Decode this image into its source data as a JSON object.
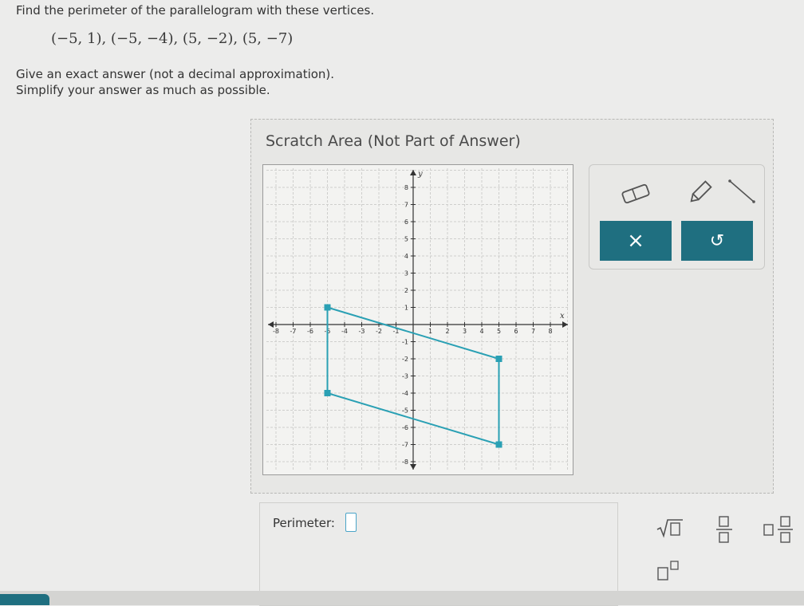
{
  "question": {
    "prompt": "Find the perimeter of the parallelogram with these vertices.",
    "vertices": "(−5, 1), (−5, −4), (5, −2), (5, −7)",
    "instruction_exact": "Give an exact answer (not a decimal approximation).",
    "instruction_simplify": "Simplify your answer as much as possible."
  },
  "scratch": {
    "title": "Scratch Area (Not Part of Answer)"
  },
  "tools": {
    "eraser_icon": "eraser-icon",
    "pencil_icon": "pencil-icon",
    "line_icon": "line-tool-icon",
    "clear_label": "×",
    "undo_label": "↺"
  },
  "answer": {
    "label": "Perimeter:",
    "value": ""
  },
  "colors": {
    "accent": "#1f6f80",
    "shape": "#2aa0b4",
    "input_border": "#4aa4c8"
  },
  "chart_data": {
    "type": "scatter",
    "xlabel": "x",
    "ylabel": "y",
    "xlim": [
      -9,
      9
    ],
    "ylim": [
      -9,
      9
    ],
    "grid": true,
    "x_ticks": [
      -8,
      -7,
      -6,
      -5,
      -4,
      -3,
      -2,
      -1,
      1,
      2,
      3,
      4,
      5,
      6,
      7,
      8
    ],
    "y_ticks": [
      -8,
      -7,
      -6,
      -5,
      -4,
      -3,
      -2,
      -1,
      1,
      2,
      3,
      4,
      5,
      6,
      7,
      8
    ],
    "polygon": [
      [
        -5,
        1
      ],
      [
        5,
        -2
      ],
      [
        5,
        -7
      ],
      [
        -5,
        -4
      ]
    ],
    "points": [
      [
        -5,
        1
      ],
      [
        -5,
        -4
      ],
      [
        5,
        -2
      ],
      [
        5,
        -7
      ]
    ]
  }
}
